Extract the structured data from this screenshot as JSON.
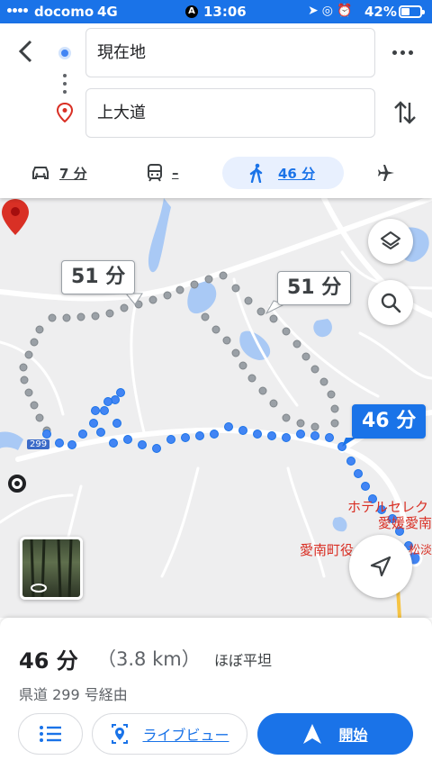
{
  "status_bar": {
    "carrier": "docomo",
    "network": "4G",
    "time": "13:06",
    "battery_percent": "42%",
    "battery_level": 0.42
  },
  "search": {
    "origin": "現在地",
    "destination": "上大道"
  },
  "travel_modes": [
    {
      "icon": "car-icon",
      "label": "7 分"
    },
    {
      "icon": "train-icon",
      "label": "–"
    },
    {
      "icon": "walk-icon",
      "label": "46 分",
      "selected": true
    },
    {
      "icon": "airplane-icon",
      "label": ""
    }
  ],
  "map": {
    "callouts": {
      "alt_route_1": "51 分",
      "alt_route_2": "51 分",
      "selected_route": "46 分"
    },
    "route_shield": "299",
    "pois": [
      "ホテルセレク",
      "愛媛愛南",
      "愛南町役",
      "松淡"
    ]
  },
  "summary": {
    "duration": "46 分",
    "distance": "（3.8 km）",
    "terrain": "ほぼ平坦",
    "via": "県道 299 号経由"
  },
  "actions": {
    "live_view": "ライブビュー",
    "start": "開始"
  },
  "colors": {
    "accent": "#1a73e8",
    "alt_route": "#9aa0a6",
    "pin": "#d93025",
    "water": "#a9c9f5"
  }
}
